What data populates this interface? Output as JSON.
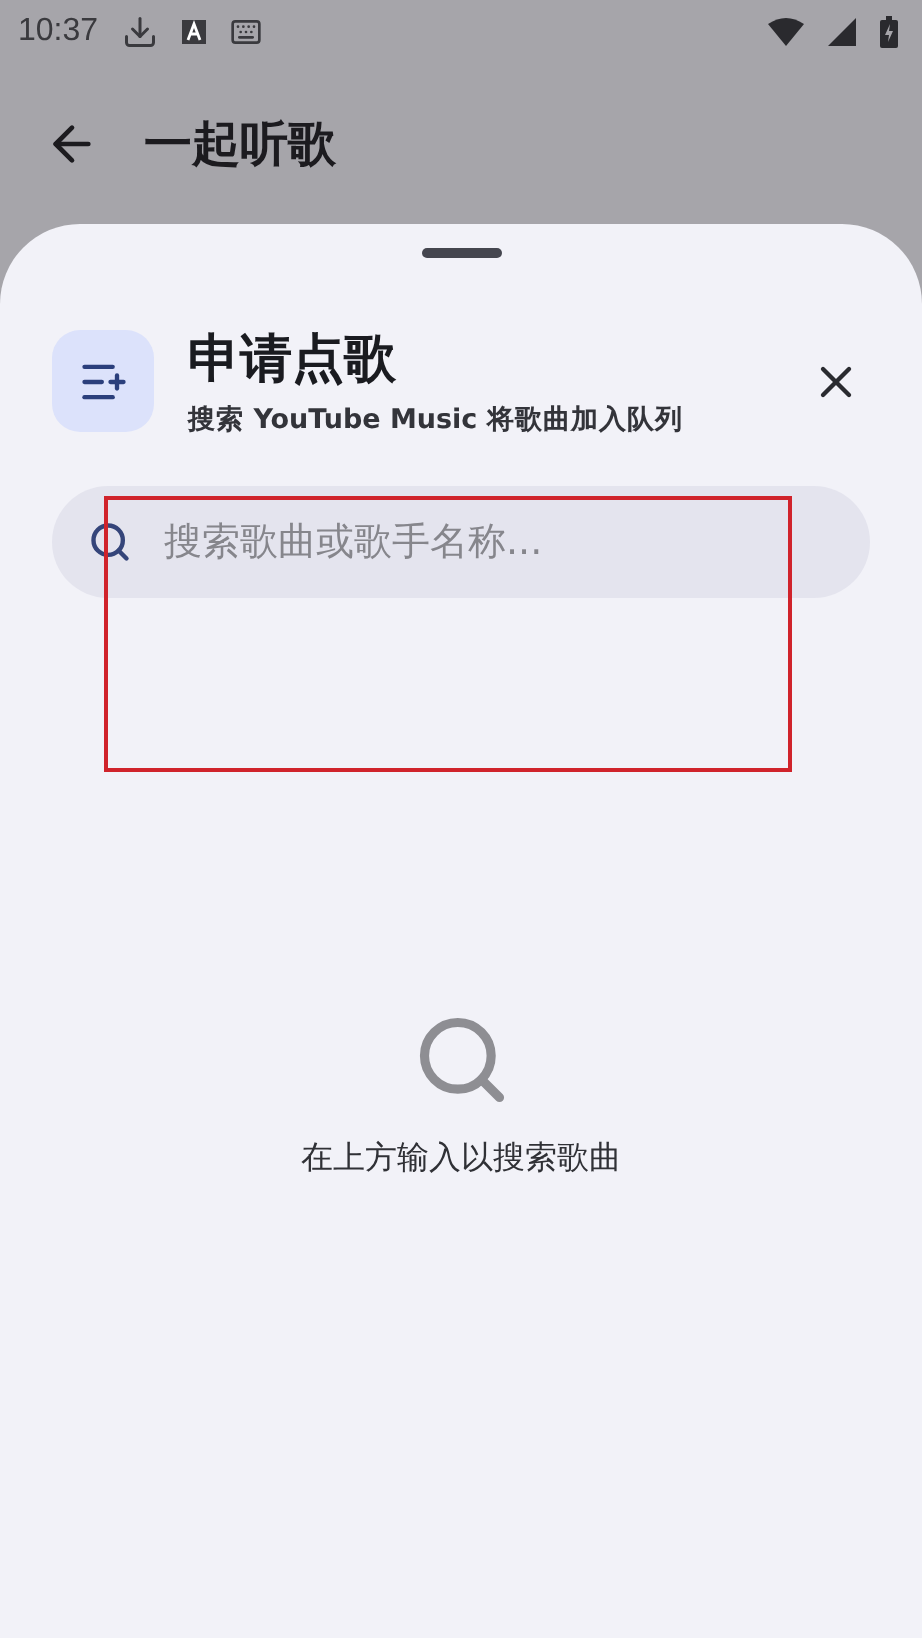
{
  "status_bar": {
    "time": "10:37"
  },
  "app_bar": {
    "title": "一起听歌"
  },
  "sheet": {
    "title": "申请点歌",
    "subtitle": "搜索 YouTube Music 将歌曲加入队列",
    "search": {
      "placeholder": "搜索歌曲或歌手名称..."
    },
    "empty_message": "在上方输入以搜索歌曲"
  }
}
